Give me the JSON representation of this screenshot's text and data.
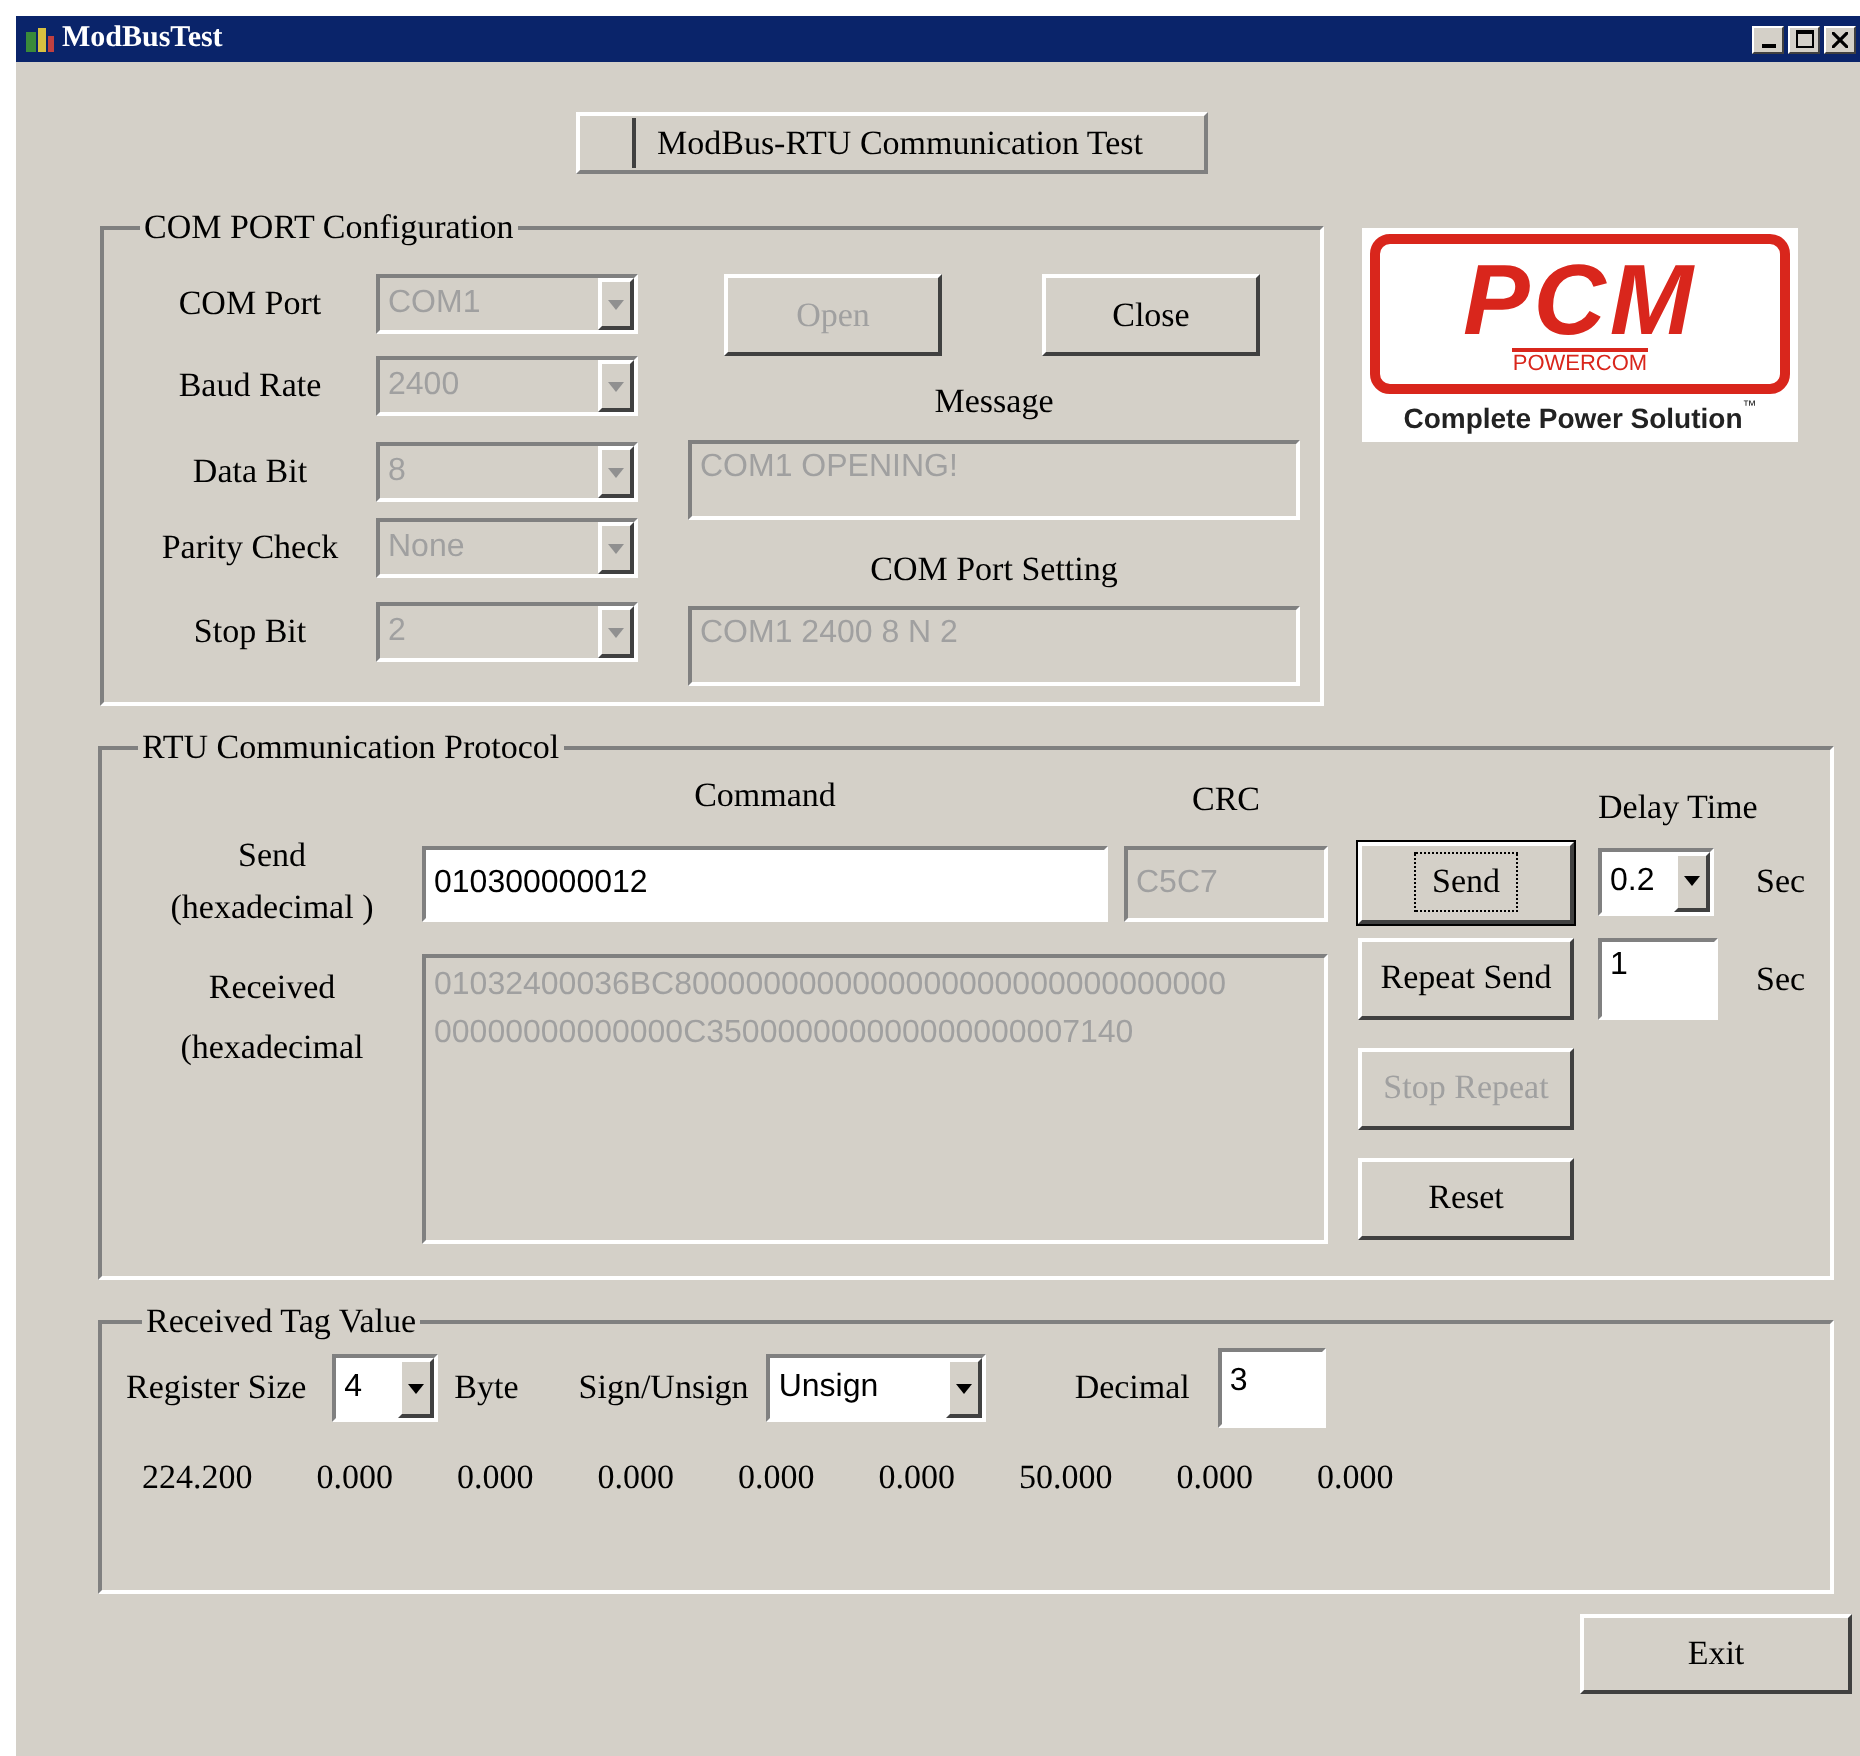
{
  "window": {
    "title": "ModBusTest"
  },
  "header_button": {
    "label": "ModBus-RTU Communication Test"
  },
  "com_config": {
    "title": "COM PORT Configuration",
    "fields": [
      {
        "label": "COM Port",
        "value": "COM1",
        "disabled": true
      },
      {
        "label": "Baud Rate",
        "value": "2400",
        "disabled": true
      },
      {
        "label": "Data Bit",
        "value": "8",
        "disabled": true
      },
      {
        "label": "Parity Check",
        "value": "None",
        "disabled": true
      },
      {
        "label": "Stop Bit",
        "value": "2",
        "disabled": true
      }
    ],
    "buttons": [
      {
        "label": "Open",
        "disabled": true
      },
      {
        "label": "Close",
        "disabled": false
      }
    ],
    "message": {
      "label": "Message",
      "value": "COM1 OPENING!"
    },
    "port_setting": {
      "label": "COM Port Setting",
      "value": "COM1 2400 8 N 2"
    }
  },
  "logo": {
    "mark": "PCM",
    "brand": "POWERCOM",
    "tagline": "Complete Power Solution",
    "trademark": "™"
  },
  "rtu": {
    "title": "RTU Communication Protocol",
    "command_label": "Command",
    "crc_label": "CRC",
    "delay_label": "Delay Time",
    "send_label": "Send\n(hexadecimal )",
    "command": "010300000012",
    "crc": {
      "value": "C5C7",
      "disabled": true
    },
    "received_label": "Received\n(hexadecimal",
    "received": "01032400036BC8000000000000000000000000000000\n00000000000000C350000000000000000007140",
    "buttons": [
      {
        "label": "Send",
        "disabled": false,
        "focused": true
      },
      {
        "label": "Repeat Send",
        "disabled": false,
        "focused": false
      },
      {
        "label": "Stop Repeat",
        "disabled": true,
        "focused": false
      },
      {
        "label": "Reset",
        "disabled": false,
        "focused": false
      }
    ],
    "delay": {
      "value": "0.2",
      "unit": "Sec"
    },
    "repeat_interval": {
      "value": "1",
      "unit": "Sec"
    }
  },
  "tag_value": {
    "title": "Received Tag Value",
    "register_size_label": "Register Size",
    "register_size": "4",
    "register_unit": "Byte",
    "sign_label": "Sign/Unsign",
    "sign": "Unsign",
    "decimal_label": "Decimal",
    "decimal": "3",
    "values": [
      "224.200",
      "0.000",
      "0.000",
      "0.000",
      "0.000",
      "0.000",
      "50.000",
      "0.000",
      "0.000"
    ]
  },
  "exit_button": {
    "label": "Exit"
  }
}
